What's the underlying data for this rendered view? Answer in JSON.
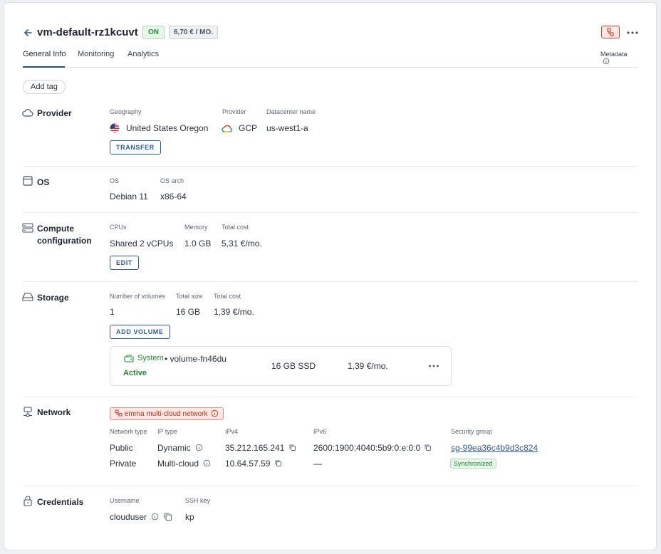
{
  "header": {
    "back_icon": "arrow-left-icon",
    "title": "vm-default-rz1kcuvt",
    "status": "ON",
    "price": "6,70 € / MO.",
    "more_icon": "more-horizontal-icon"
  },
  "tabs": [
    {
      "label": "General Info",
      "active": true
    },
    {
      "label": "Monitoring",
      "active": false
    },
    {
      "label": "Analytics",
      "active": false
    }
  ],
  "metadata_label": "Metadata",
  "add_tag_label": "Add tag",
  "provider": {
    "title": "Provider",
    "labels": {
      "geography": "Geography",
      "provider": "Provider",
      "datacenter": "Datacenter name"
    },
    "geography": "United States Oregon",
    "provider_name": "GCP",
    "datacenter": "us-west1-a",
    "transfer_label": "TRANSFER"
  },
  "os": {
    "title": "OS",
    "labels": {
      "os": "OS",
      "arch": "OS arch"
    },
    "os": "Debian 11",
    "arch": "x86-64"
  },
  "compute": {
    "title_line1": "Compute",
    "title_line2": "configuration",
    "labels": {
      "cpus": "CPUs",
      "memory": "Memory",
      "cost": "Total cost"
    },
    "cpus": "Shared 2 vCPUs",
    "memory": "1.0 GB",
    "cost": "5,31 €/mo.",
    "edit_label": "EDIT"
  },
  "storage": {
    "title": "Storage",
    "labels": {
      "volumes": "Number of volumes",
      "size": "Total size",
      "cost": "Total cost"
    },
    "volumes": "1",
    "size": "16 GB",
    "cost": "1,39 €/mo.",
    "add_volume_label": "ADD VOLUME",
    "volume": {
      "type": "System",
      "name": "• volume-fn46du",
      "status": "Active",
      "size": "16 GB SSD",
      "cost": "1,39 €/mo."
    }
  },
  "network": {
    "title": "Network",
    "badge": "emma multi-cloud network",
    "labels": {
      "type": "Network type",
      "ip_type": "IP type",
      "ipv4": "IPv4",
      "ipv6": "IPv6",
      "sg": "Security group"
    },
    "rows": [
      {
        "type": "Public",
        "ip_type": "Dynamic",
        "ipv4": "35.212.165.241",
        "ipv6": "2600:1900:4040:5b9:0:e:0:0"
      },
      {
        "type": "Private",
        "ip_type": "Multi-cloud",
        "ipv4": "10.64.57.59",
        "ipv6": "—"
      }
    ],
    "security_group": "sg-99ea36c4b9d3c824",
    "sg_status": "Synchronized"
  },
  "credentials": {
    "title": "Credentials",
    "labels": {
      "username": "Username",
      "ssh": "SSH key"
    },
    "username": "clouduser",
    "ssh": "kp"
  },
  "colors": {
    "accent": "#2b5aa8",
    "on": "#1f8a37",
    "danger": "#b3321f"
  }
}
